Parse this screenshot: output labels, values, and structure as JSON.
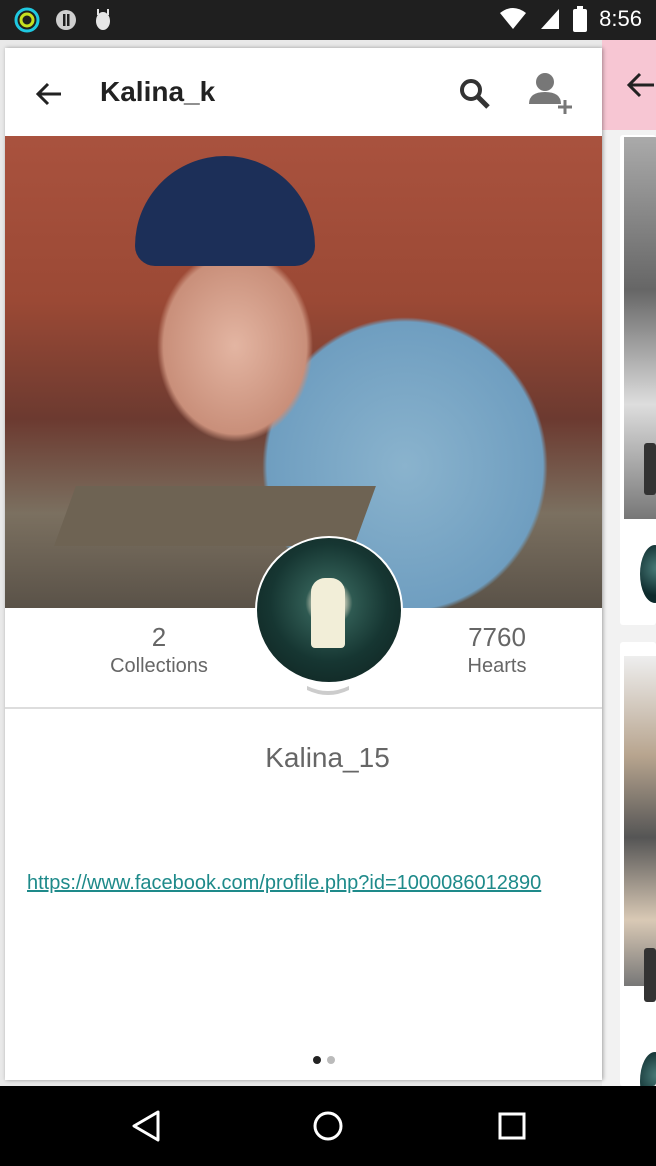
{
  "status_bar": {
    "time": "8:56",
    "left_icons": [
      "ring-notification-icon",
      "info-icon",
      "android-debug-icon"
    ],
    "right_icons": [
      "wifi-icon",
      "cell-signal-icon",
      "battery-icon"
    ]
  },
  "toolbar": {
    "title": "Kalina_k",
    "icons": [
      "back-arrow-icon",
      "search-icon",
      "add-user-icon"
    ]
  },
  "side_panel": {
    "toolbar_color": "#f7c6d3",
    "icon": "back-arrow-icon"
  },
  "profile": {
    "collections_count": "2",
    "collections_label": "Collections",
    "hearts_count": "7760",
    "hearts_label": "Hearts",
    "username": "Kalina_15",
    "link": "https://www.facebook.com/profile.php?id=1000086012890"
  },
  "pager": {
    "total": 2,
    "active": 1
  },
  "nav_bar": {
    "icons": [
      "back-triangle-icon",
      "home-circle-icon",
      "recents-square-icon"
    ]
  },
  "colors": {
    "link": "#1e8a8a",
    "accent_pink": "#f7c6d3"
  }
}
